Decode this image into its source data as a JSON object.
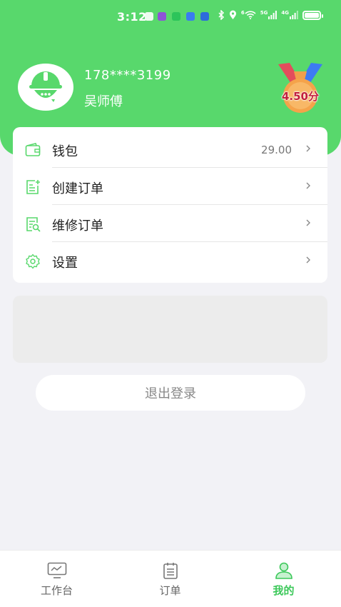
{
  "status_bar": {
    "time": "3:12",
    "network_1": "5G",
    "network_2": "4G",
    "wifi_badge": "6"
  },
  "profile": {
    "phone": "178****3199",
    "name": "吴师傅",
    "rating": "4.50分"
  },
  "menu": {
    "items": [
      {
        "label": "钱包",
        "value": "29.00",
        "icon": "wallet-icon"
      },
      {
        "label": "创建订单",
        "value": "",
        "icon": "create-order-icon"
      },
      {
        "label": "维修订单",
        "value": "",
        "icon": "repair-order-icon"
      },
      {
        "label": "设置",
        "value": "",
        "icon": "gear-icon"
      }
    ]
  },
  "logout_label": "退出登录",
  "bottom_nav": {
    "items": [
      {
        "label": "工作台",
        "icon": "monitor-icon"
      },
      {
        "label": "订单",
        "icon": "calendar-icon"
      },
      {
        "label": "我的",
        "icon": "user-icon"
      }
    ],
    "active_index": 2
  },
  "colors": {
    "brand": "#58d86c",
    "active_tab": "#3cc85a",
    "rating_text": "#c21f3c"
  }
}
